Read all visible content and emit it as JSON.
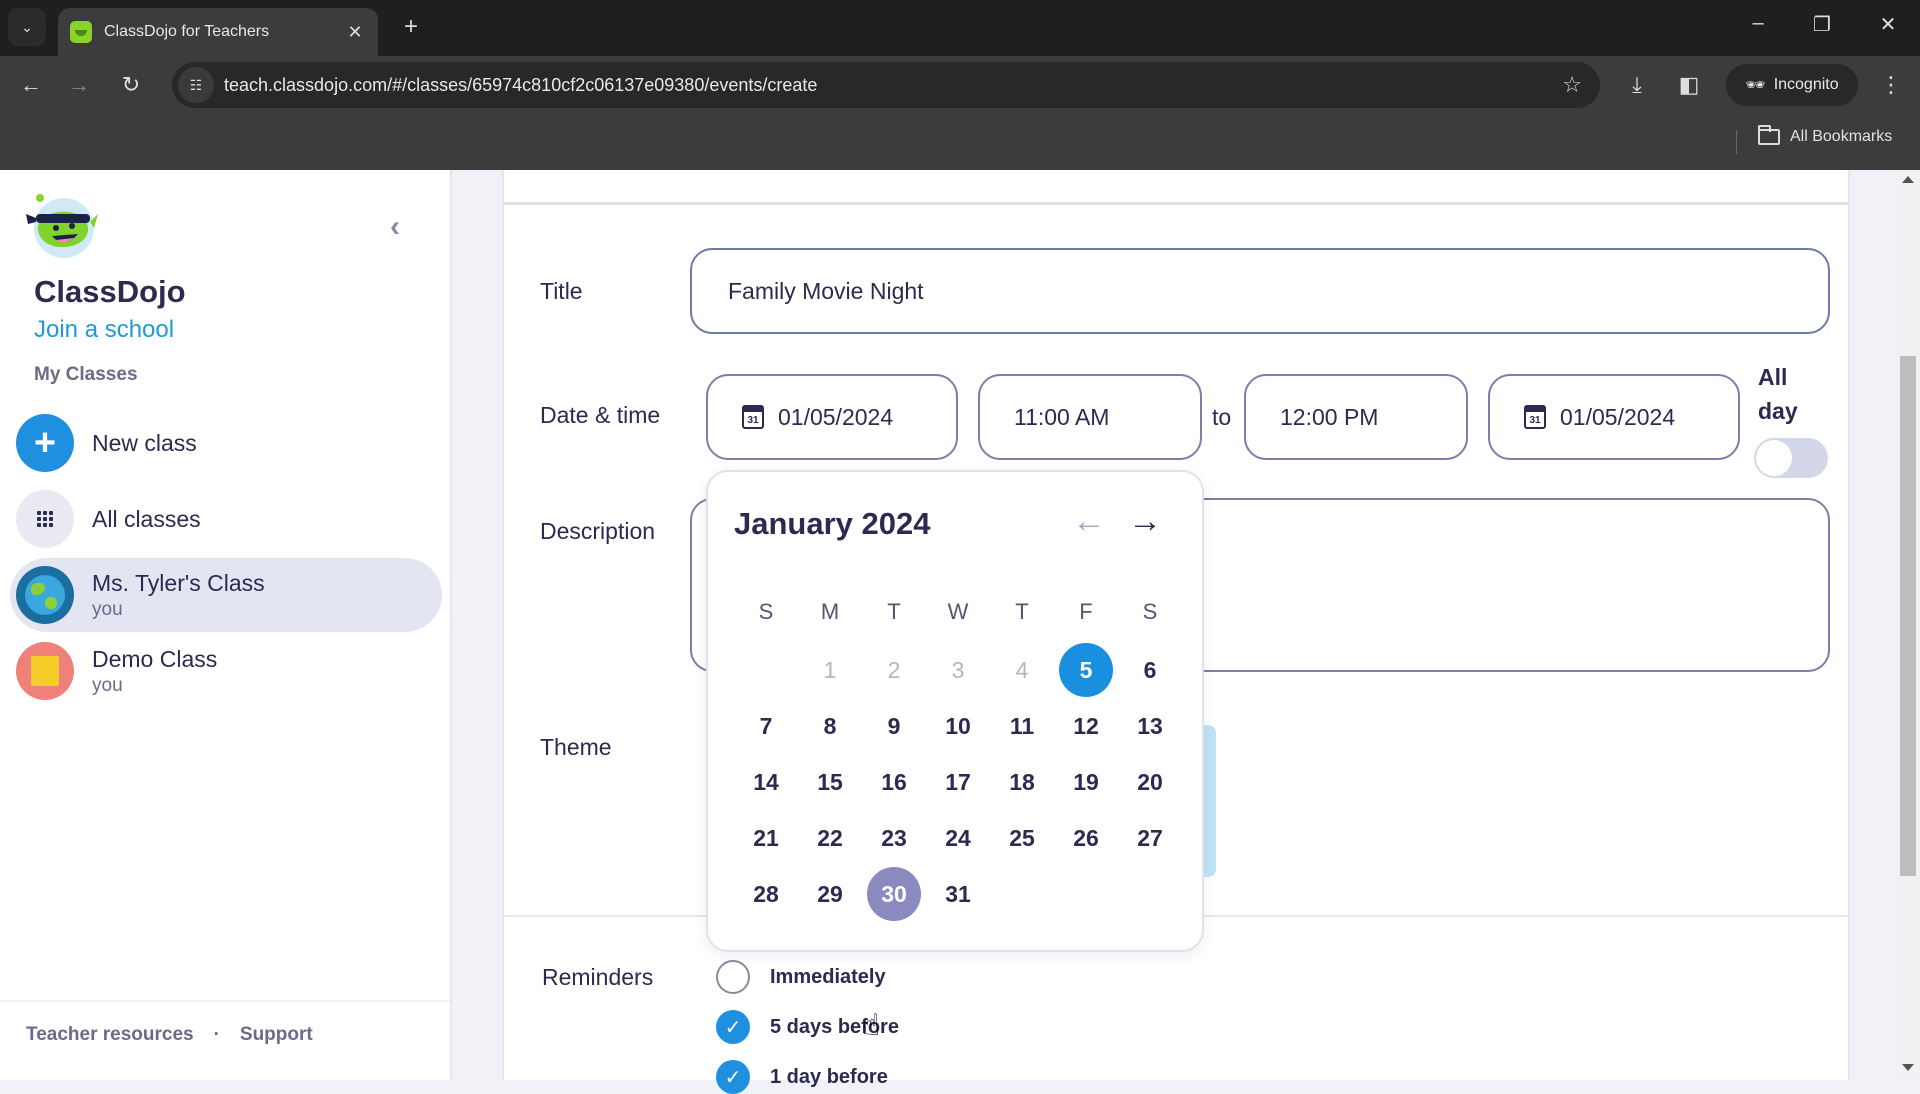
{
  "browser": {
    "tab_title": "ClassDojo for Teachers",
    "tab_close": "✕",
    "new_tab": "+",
    "url": "teach.classdojo.com/#/classes/65974c810cf2c06137e09380/events/create",
    "incognito_label": "Incognito",
    "all_bookmarks": "All Bookmarks"
  },
  "sidebar": {
    "brand": "ClassDojo",
    "join_school": "Join a school",
    "section_title": "My Classes",
    "items": [
      {
        "label": "New class",
        "icon": "plus-icon"
      },
      {
        "label": "All classes",
        "icon": "grid-icon"
      },
      {
        "label": "Ms. Tyler's Class",
        "sub": "you",
        "icon": "globe-icon",
        "active": true
      },
      {
        "label": "Demo Class",
        "sub": "you",
        "icon": "note-icon"
      }
    ],
    "footer": {
      "teacher_resources": "Teacher resources",
      "separator": "·",
      "support": "Support"
    }
  },
  "form": {
    "title_label": "Title",
    "title_value": "Family Movie Night",
    "datetime_label": "Date & time",
    "start_date": "01/05/2024",
    "start_time": "11:00 AM",
    "to_label": "to",
    "end_time": "12:00 PM",
    "end_date": "01/05/2024",
    "calendar_icon_text": "31",
    "all_day_label": "All day",
    "all_day_on": false,
    "description_label": "Description",
    "description_value": "",
    "theme_label": "Theme",
    "reminders_label": "Reminders",
    "reminders": [
      {
        "label": "Immediately",
        "checked": false
      },
      {
        "label": "5 days before",
        "checked": true
      },
      {
        "label": "1 day before",
        "checked": true
      }
    ]
  },
  "datepicker": {
    "month_label": "January 2024",
    "prev": "←",
    "next": "→",
    "weekdays": [
      "S",
      "M",
      "T",
      "W",
      "T",
      "F",
      "S"
    ],
    "leading_blanks": 1,
    "days": 31,
    "disabled_through": 4,
    "selected_day": 5,
    "hover_day": 30
  },
  "colors": {
    "accent_blue": "#1a8fe0",
    "hover_purple": "#8a8ac0",
    "text_dark": "#2c2a50",
    "link_blue": "#1f9ad6"
  }
}
